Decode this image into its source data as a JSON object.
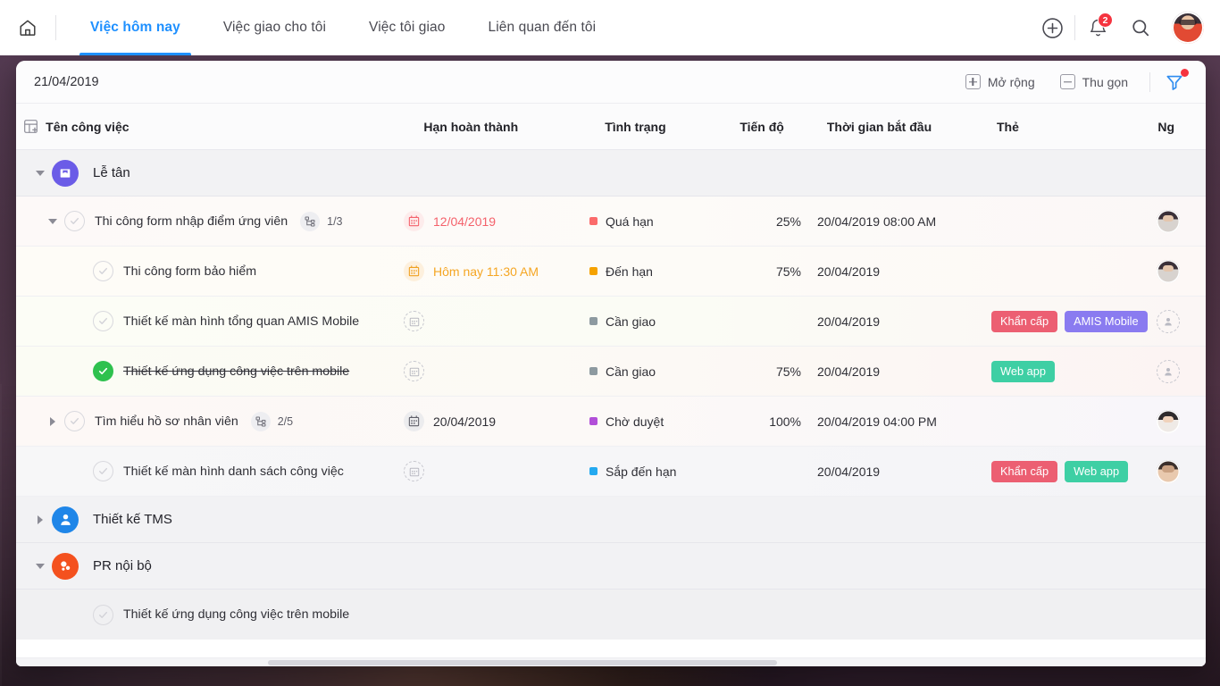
{
  "topnav": {
    "home_icon": "home-icon",
    "tabs": [
      {
        "label": "Việc hôm nay",
        "active": true
      },
      {
        "label": "Việc giao cho tôi",
        "active": false
      },
      {
        "label": "Việc tôi giao",
        "active": false
      },
      {
        "label": "Liên quan đến tôi",
        "active": false
      }
    ],
    "add_icon": "plus-circle-icon",
    "bell_icon": "bell-icon",
    "notification_count": "2",
    "search_icon": "search-icon",
    "avatar": "user-avatar"
  },
  "toolbar": {
    "date": "21/04/2019",
    "expand_label": "Mở rộng",
    "collapse_label": "Thu gọn",
    "filter_icon": "filter-icon",
    "filter_has_badge": true
  },
  "table": {
    "columns": [
      "Tên công việc",
      "Hạn hoàn thành",
      "Tình trạng",
      "Tiến độ",
      "Thời gian bắt đầu",
      "Thẻ",
      "Ng"
    ],
    "add_column_icon": "add-column-icon",
    "rows": [
      {
        "kind": "group",
        "twisty": "down",
        "avatar_icon": "briefcase-icon",
        "avatar_color": "#6b5ce7",
        "label": "Lễ tân"
      },
      {
        "kind": "task",
        "tint": "t-over",
        "twisty": "down",
        "indent": 1,
        "check": "unchecked",
        "name": "Thi công form nhập điểm  ứng viên",
        "subtask_icon": "subtask-icon",
        "subtask_count": "1/3",
        "due_icon": "calendar-red",
        "due": "12/04/2019",
        "due_color": "red",
        "status": "Quá hạn",
        "status_color": "#fb6b6b",
        "progress": "25%",
        "start": "20/04/2019 08:00 AM",
        "tags": [],
        "person": "ph1"
      },
      {
        "kind": "task",
        "tint": "t-due",
        "twisty": "none",
        "indent": 2,
        "check": "unchecked",
        "name": "Thi công form bảo hiểm",
        "subtask_count": "",
        "due_icon": "calendar-orange",
        "due": "Hôm nay 11:30 AM",
        "due_color": "orange",
        "status": "Đến hạn",
        "status_color": "#f5a200",
        "progress": "75%",
        "start": "20/04/2019",
        "tags": [],
        "person": "ph1"
      },
      {
        "kind": "task",
        "tint": "t-green",
        "twisty": "none",
        "indent": 2,
        "check": "unchecked",
        "name": "Thiết kế màn hình tổng quan AMIS Mobile",
        "subtask_count": "",
        "due_icon": "calendar-empty",
        "due": "",
        "due_color": "grey",
        "status": "Cần giao",
        "status_color": "#8d9aa0",
        "progress": "",
        "start": "20/04/2019",
        "tags": [
          {
            "label": "Khẩn cấp",
            "color": "#ec5f72"
          },
          {
            "label": "AMIS Mobile",
            "color": "#8a7bf0"
          }
        ],
        "person": "empty"
      },
      {
        "kind": "task",
        "tint": "t-green2",
        "twisty": "none",
        "indent": 2,
        "check": "done",
        "name": "Thiết kế ứng dụng công việc trên mobile",
        "strikethrough": true,
        "subtask_count": "",
        "due_icon": "calendar-empty",
        "due": "",
        "due_color": "grey",
        "status": "Cần giao",
        "status_color": "#8d9aa0",
        "progress": "75%",
        "start": "20/04/2019",
        "tags": [
          {
            "label": "Web app",
            "color": "#3ecfa4"
          }
        ],
        "person": "empty"
      },
      {
        "kind": "task",
        "tint": "t-pink",
        "twisty": "right",
        "indent": 1,
        "check": "unchecked",
        "name": "Tìm hiểu hồ sơ nhân viên",
        "subtask_icon": "subtask-icon",
        "subtask_count": "2/5",
        "due_icon": "calendar-grey",
        "due": "20/04/2019",
        "due_color": "grey",
        "status": "Chờ duyệt",
        "status_color": "#b14fd8",
        "progress": "100%",
        "start": "20/04/2019 04:00 PM",
        "tags": [],
        "person": "ph2"
      },
      {
        "kind": "task",
        "tint": "t-grey",
        "twisty": "none",
        "indent": 2,
        "check": "unchecked",
        "name": "Thiết kế màn hình danh sách công việc",
        "subtask_count": "",
        "due_icon": "calendar-empty",
        "due": "",
        "due_color": "grey",
        "status": "Sắp đến hạn",
        "status_color": "#24a9f0",
        "progress": "",
        "start": "20/04/2019",
        "tags": [
          {
            "label": "Khẩn cấp",
            "color": "#ec5f72"
          },
          {
            "label": "Web app",
            "color": "#3ecfa4"
          }
        ],
        "person": "ph3"
      },
      {
        "kind": "group",
        "twisty": "right",
        "avatar_icon": "person-icon",
        "avatar_color": "#1f86e8",
        "label": "Thiết kế TMS"
      },
      {
        "kind": "group",
        "twisty": "down",
        "avatar_icon": "megaphone-icon",
        "avatar_color": "#f4511e",
        "label": "PR nội bộ"
      },
      {
        "kind": "task",
        "tint": "t-plain",
        "twisty": "none",
        "indent": 2,
        "check": "unchecked",
        "name": "Thiết kế ứng dụng công việc trên mobile",
        "subtask_count": "",
        "due_icon": "",
        "due": "",
        "due_color": "grey",
        "status": "",
        "status_color": "",
        "progress": "",
        "start": "",
        "tags": [],
        "person": ""
      }
    ]
  },
  "scrollbar": {
    "orientation": "horizontal"
  }
}
